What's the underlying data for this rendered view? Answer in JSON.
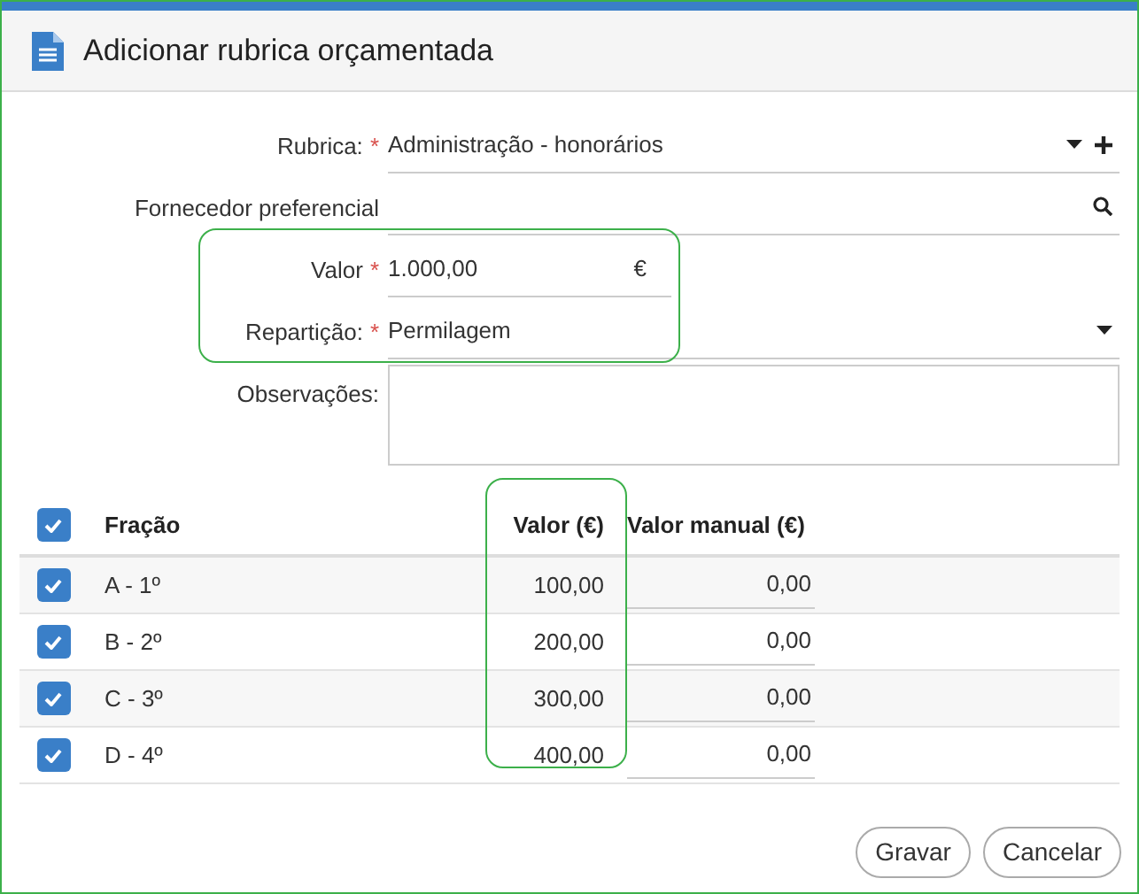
{
  "dialog": {
    "title": "Adicionar rubrica orçamentada"
  },
  "form": [
    {
      "kind": "select",
      "label": "Rubrica:",
      "required_mark": "*",
      "value": "Administração - honorários",
      "addable": true
    },
    {
      "kind": "search",
      "label": "Fornecedor preferencial"
    },
    {
      "kind": "money",
      "label": "Valor",
      "required_mark": "*",
      "value": "1.000,00",
      "suffix": "€"
    },
    {
      "kind": "select",
      "label": "Repartição:",
      "required_mark": "*",
      "value": "Permilagem",
      "addable": false
    },
    {
      "kind": "textarea",
      "label": "Observações:"
    }
  ],
  "table": {
    "all_checked": true,
    "columns": [
      "Fração",
      "Valor (€)",
      "Valor manual (€)"
    ],
    "rows": [
      {
        "checked": true,
        "fraction": "A - 1º",
        "value": "100,00",
        "manual": "0,00"
      },
      {
        "checked": true,
        "fraction": "B - 2º",
        "value": "200,00",
        "manual": "0,00"
      },
      {
        "checked": true,
        "fraction": "C - 3º",
        "value": "300,00",
        "manual": "0,00"
      },
      {
        "checked": true,
        "fraction": "D - 4º",
        "value": "400,00",
        "manual": "0,00"
      }
    ]
  },
  "buttons": [
    "Gravar",
    "Cancelar"
  ]
}
